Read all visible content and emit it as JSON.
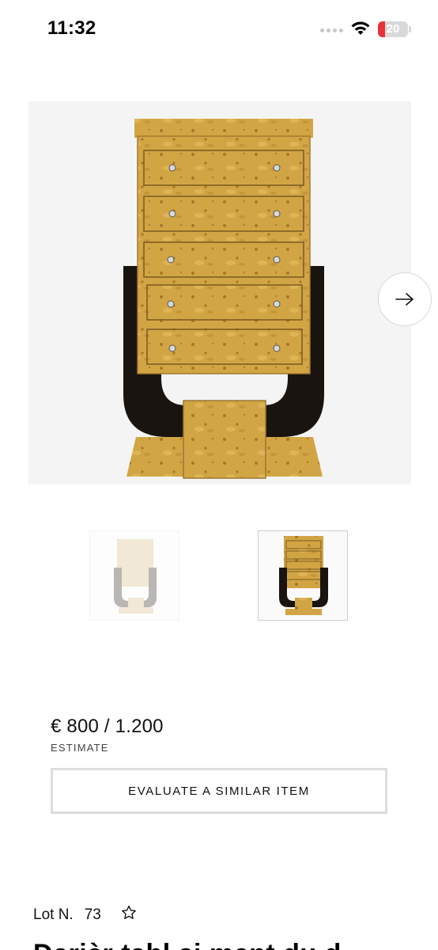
{
  "status_bar": {
    "time": "11:32",
    "battery_level": "20",
    "icons": [
      "signal-dots-icon",
      "wifi-icon",
      "battery-icon"
    ]
  },
  "gallery": {
    "next_icon": "arrow-right-icon",
    "image_alt": "",
    "thumbnails": [
      "thumbnail-1",
      "thumbnail-2"
    ]
  },
  "estimate": {
    "value": "€ 800 / 1.200",
    "label": "ESTIMATE"
  },
  "actions": {
    "evaluate_label": "EVALUATE A SIMILAR ITEM"
  },
  "lot": {
    "label": "Lot N.",
    "number": "73",
    "favorite_icon": "star-outline-icon",
    "title_partial": "Derièr tabl ai ment du d"
  },
  "colors": {
    "wood": "#c99a3a",
    "wood_light": "#e0b85c",
    "lacquer": "#1a1410",
    "battery_red": "#e8333c"
  }
}
